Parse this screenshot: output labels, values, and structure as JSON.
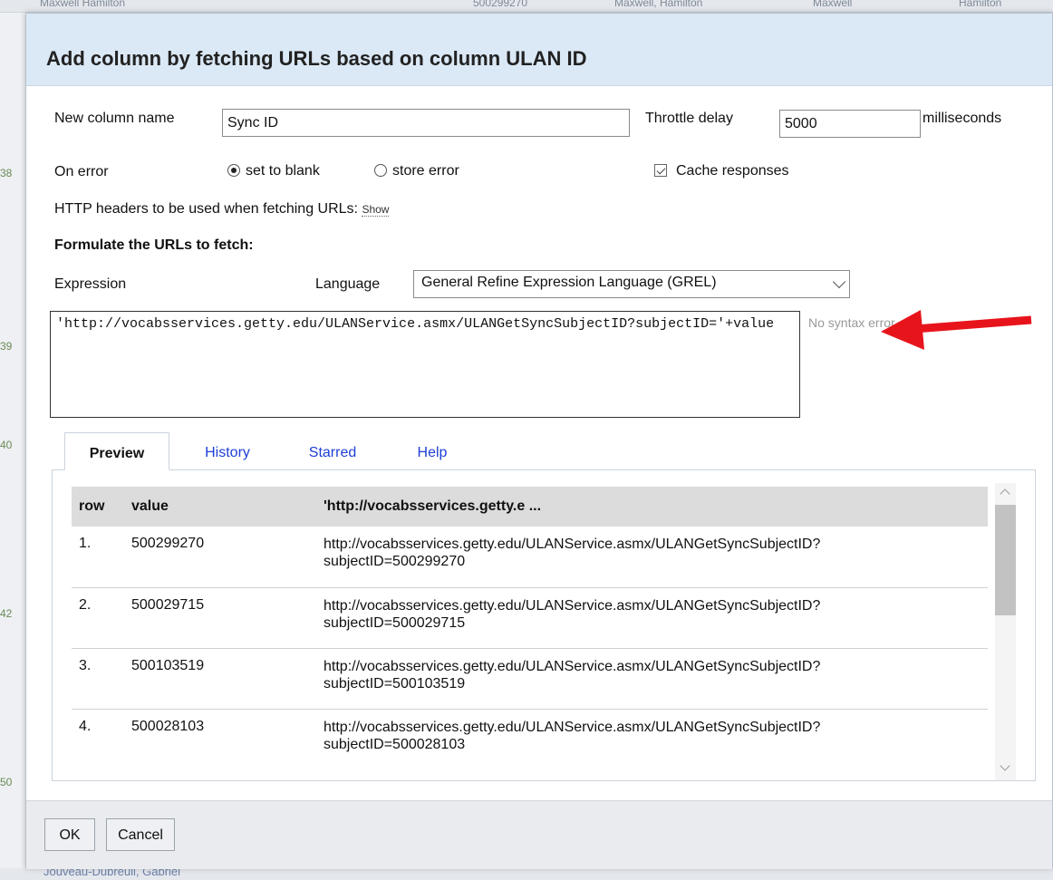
{
  "background": {
    "top_row": [
      "Maxwell Hamilton",
      "500299270",
      "Maxwell, Hamilton",
      "Maxwell",
      "Hamilton"
    ],
    "bottom_row": "Jouveau-Dubreuil, Gabriel",
    "gutter_numbers": [
      "38",
      "39",
      "40",
      "42",
      "50"
    ]
  },
  "dialog": {
    "title": "Add column by fetching URLs based on column ULAN ID",
    "new_column": {
      "label": "New column name",
      "value": "Sync ID"
    },
    "throttle": {
      "label": "Throttle delay",
      "value": "5000",
      "unit": "milliseconds"
    },
    "on_error": {
      "label": "On error",
      "options": [
        {
          "label": "set to blank",
          "selected": true
        },
        {
          "label": "store error",
          "selected": false
        }
      ]
    },
    "cache": {
      "label": "Cache responses",
      "checked": true
    },
    "http_headers": {
      "label": "HTTP headers to be used when fetching URLs:",
      "link": "Show"
    },
    "formulate_heading": "Formulate the URLs to fetch:",
    "expression_label": "Expression",
    "language": {
      "label": "Language",
      "value": "General Refine Expression Language (GREL)"
    },
    "expression_value": "'http://vocabsservices.getty.edu/ULANService.asmx/ULANGetSyncSubjectID?subjectID='+value",
    "expression_status": "No syntax error.",
    "tabs": [
      "Preview",
      "History",
      "Starred",
      "Help"
    ],
    "active_tab": "Preview",
    "preview": {
      "columns": [
        "row",
        "value",
        "'http://vocabsservices.getty.e ..."
      ],
      "rows": [
        {
          "row": "1.",
          "value": "500299270",
          "url_line1": "http://vocabsservices.getty.edu/ULANService.asmx/ULANGetSyncSubjectID?",
          "url_line2": "subjectID=500299270"
        },
        {
          "row": "2.",
          "value": "500029715",
          "url_line1": "http://vocabsservices.getty.edu/ULANService.asmx/ULANGetSyncSubjectID?",
          "url_line2": "subjectID=500029715"
        },
        {
          "row": "3.",
          "value": "500103519",
          "url_line1": "http://vocabsservices.getty.edu/ULANService.asmx/ULANGetSyncSubjectID?",
          "url_line2": "subjectID=500103519"
        },
        {
          "row": "4.",
          "value": "500028103",
          "url_line1": "http://vocabsservices.getty.edu/ULANService.asmx/ULANGetSyncSubjectID?",
          "url_line2": "subjectID=500028103"
        }
      ]
    },
    "buttons": {
      "ok": "OK",
      "cancel": "Cancel"
    }
  },
  "colors": {
    "header_bg": "#dbe8f6",
    "link_blue": "#1e3fd6",
    "arrow_red": "#e8141b",
    "footer_bg": "#e9ebee"
  },
  "icons": [
    "radio-selected-icon",
    "radio-unselected-icon",
    "checkbox-checked-icon",
    "chevron-down-icon",
    "scroll-up-icon",
    "scroll-down-icon",
    "red-arrow-icon"
  ]
}
